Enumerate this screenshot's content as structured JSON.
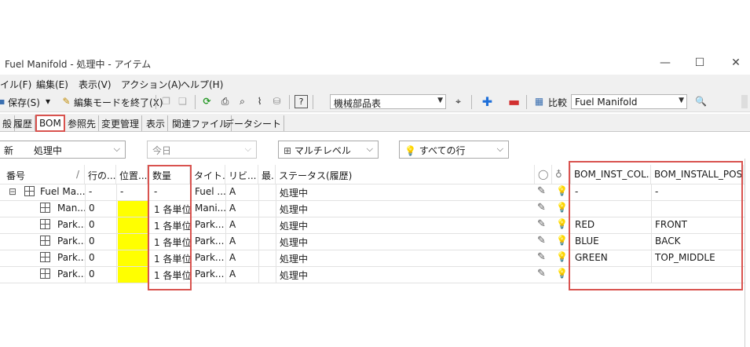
{
  "window": {
    "title": "Fuel Manifold - 処理中 - アイテム",
    "minimize": "—",
    "maximize": "☐",
    "close": "✕"
  },
  "menu": {
    "items": [
      "イル(F)",
      "編集(E)",
      "表示(V)",
      "アクション(A)",
      "ヘルプ(H)"
    ]
  },
  "toolbar": {
    "save_label": "保存(S)",
    "save_dropdown": "▾",
    "end_edit_label": "編集モードを終了(X)",
    "help_icon_label": "?",
    "category_value": "機械部品表",
    "compare_label": "比較",
    "compare_value": "Fuel Manifold",
    "find_icon_label": "🔍"
  },
  "tabs": [
    "般",
    "履歴",
    "BOM",
    "参照先",
    "変更管理",
    "表示",
    "関連ファイル",
    "データシート"
  ],
  "filters": {
    "state_left": "新",
    "state_value": "処理中",
    "date_value": "今日",
    "level_value": "マルチレベル",
    "rows_value": "すべての行"
  },
  "grid": {
    "headers": [
      "番号",
      "行の...",
      "位置...",
      "数量",
      "タイト...",
      "リビ...",
      "最.",
      "ステータス(履歴)",
      "BOM_INST_COL...",
      "BOM_INSTALL_POS"
    ],
    "header_sort_mark": "/",
    "rows": [
      {
        "number": "Fuel Ma...",
        "line": "-",
        "pos": "-",
        "qty": "-",
        "title": "Fuel ...",
        "rev": "A",
        "latest": "",
        "status": "処理中",
        "color": "-",
        "install_pos": "-"
      },
      {
        "number": "Man...",
        "line": "0",
        "pos": "",
        "qty": "1 各単位",
        "title": "Mani...",
        "rev": "A",
        "latest": "",
        "status": "処理中",
        "color": "",
        "install_pos": ""
      },
      {
        "number": "Park...",
        "line": "0",
        "pos": "",
        "qty": "1 各単位",
        "title": "Park...",
        "rev": "A",
        "latest": "",
        "status": "処理中",
        "color": "RED",
        "install_pos": "FRONT"
      },
      {
        "number": "Park...",
        "line": "0",
        "pos": "",
        "qty": "1 各単位",
        "title": "Park...",
        "rev": "A",
        "latest": "",
        "status": "処理中",
        "color": "BLUE",
        "install_pos": "BACK"
      },
      {
        "number": "Park...",
        "line": "0",
        "pos": "",
        "qty": "1 各単位",
        "title": "Park...",
        "rev": "A",
        "latest": "",
        "status": "処理中",
        "color": "GREEN",
        "install_pos": "TOP_MIDDLE"
      },
      {
        "number": "Park...",
        "line": "0",
        "pos": "",
        "qty": "1 各単位",
        "title": "Park...",
        "rev": "A",
        "latest": "",
        "status": "処理中",
        "color": "",
        "install_pos": ""
      }
    ],
    "tree_toggle": "⊟",
    "highlight_color": "#ffff00",
    "annotation_color": "#d9534f"
  }
}
